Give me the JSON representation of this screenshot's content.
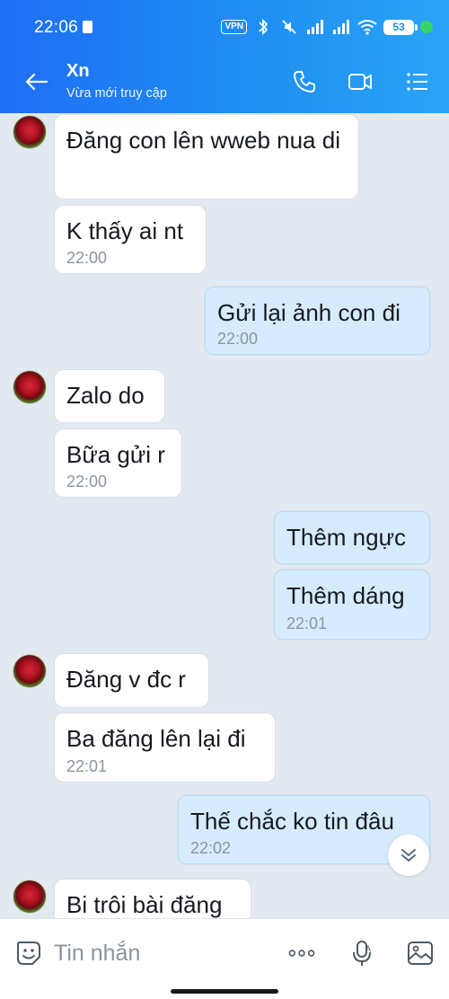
{
  "status_bar": {
    "time": "22:06",
    "vpn": "VPN",
    "battery": "53"
  },
  "header": {
    "name": "Xn",
    "subtitle": "Vừa mới truy cập"
  },
  "messages": [
    {
      "dir": "in",
      "text": "Đăng con lên wweb nua di",
      "time": ""
    },
    {
      "dir": "in",
      "text": "K thấy ai nt",
      "time": "22:00"
    },
    {
      "dir": "out",
      "text": "Gửi lại ảnh con đi",
      "time": "22:00"
    },
    {
      "dir": "in",
      "text": "Zalo do",
      "time": ""
    },
    {
      "dir": "in",
      "text": "Bữa gửi r",
      "time": "22:00"
    },
    {
      "dir": "out",
      "text": "Thêm ngực",
      "time": ""
    },
    {
      "dir": "out",
      "text": "Thêm dáng",
      "time": "22:01"
    },
    {
      "dir": "in",
      "text": "Đăng v đc r",
      "time": ""
    },
    {
      "dir": "in",
      "text": "Ba đăng lên lại đi",
      "time": "22:01"
    },
    {
      "dir": "out",
      "text": "Thế chắc ko tin đâu",
      "time": "22:02"
    },
    {
      "dir": "in",
      "text": "Bi trôi bài đăng",
      "time": ""
    }
  ],
  "input": {
    "placeholder": "Tin nhắn",
    "value": ""
  },
  "icons": {
    "back": "back-arrow-icon",
    "call": "phone-icon",
    "video": "video-call-icon",
    "menu": "list-menu-icon",
    "sticker": "sticker-icon",
    "more": "more-icon",
    "mic": "mic-icon",
    "image": "image-icon",
    "scroll": "chevron-down-icon"
  },
  "colors": {
    "header_start": "#1f6ef5",
    "header_end": "#29a4f6",
    "chat_bg": "#e2e9f1",
    "out_bubble": "#d6ecfe",
    "in_bubble": "#ffffff",
    "accent_icon": "#1f74e8"
  }
}
